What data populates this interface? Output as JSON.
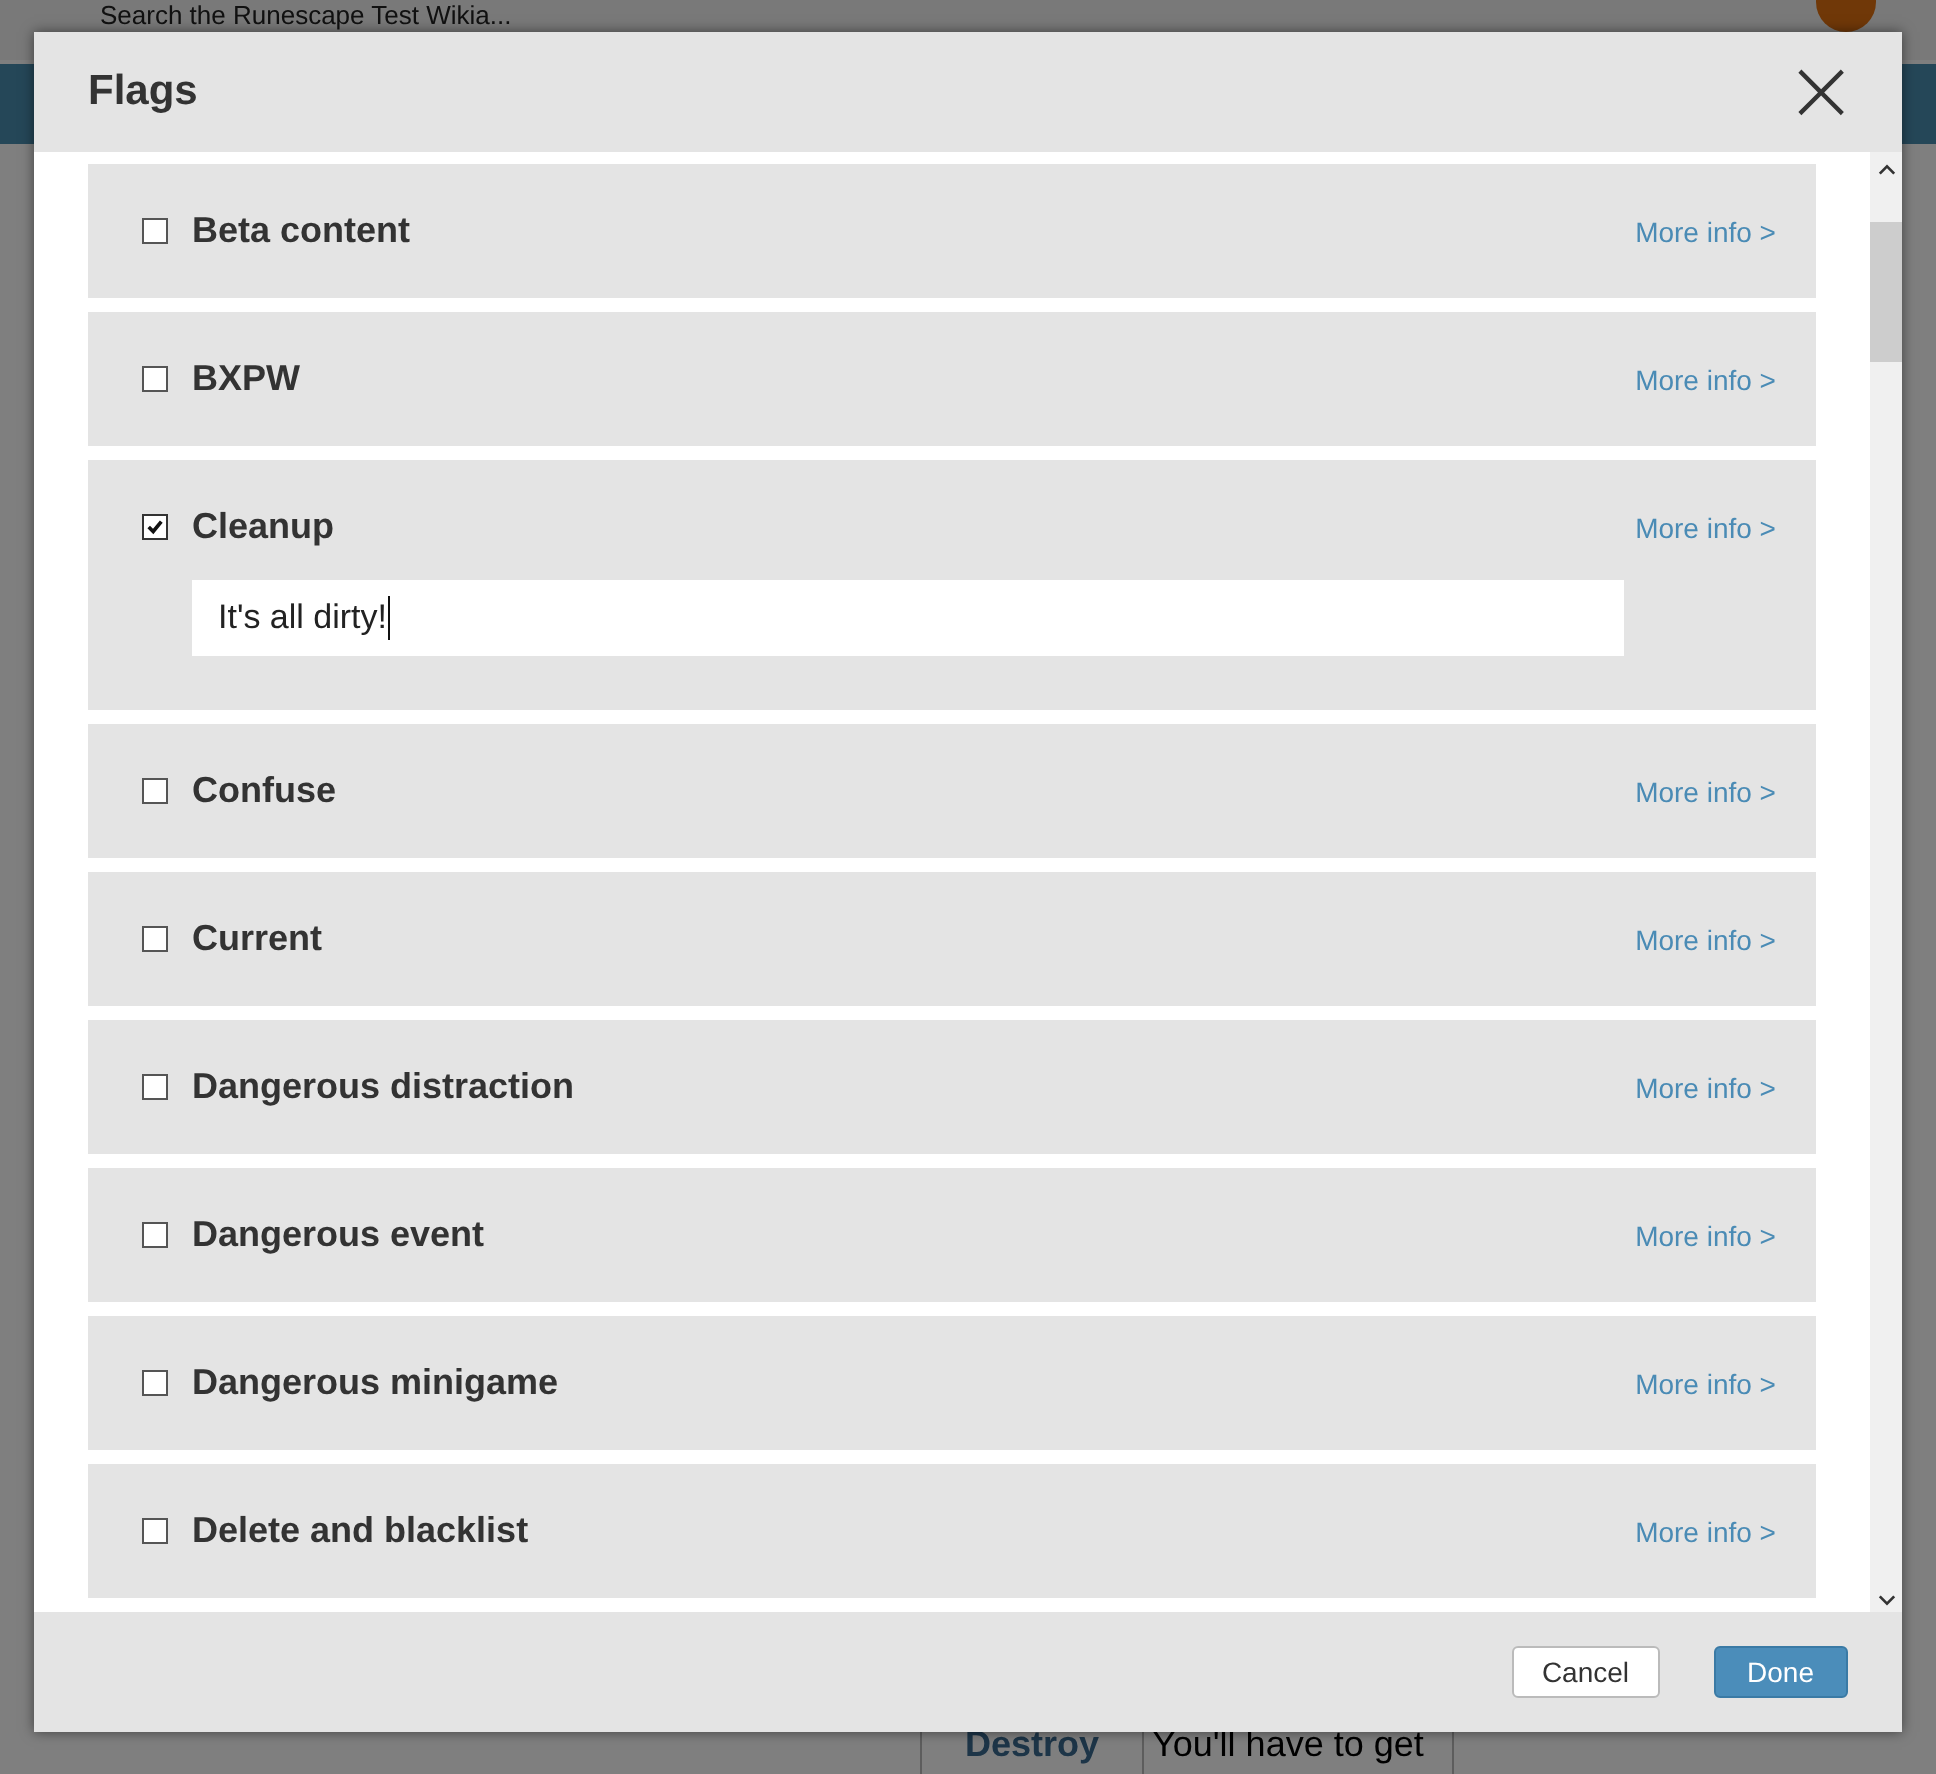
{
  "background": {
    "search_placeholder": "Search the Runescape Test Wikia...",
    "table_row": [
      "Destroy",
      "You'll have to get"
    ]
  },
  "dialog": {
    "title": "Flags",
    "close": "×"
  },
  "flags": [
    {
      "label": "Beta content",
      "checked": false,
      "link": "More info >"
    },
    {
      "label": "BXPW",
      "checked": false,
      "link": "More info >"
    },
    {
      "label": "Cleanup",
      "checked": true,
      "link": "More info >",
      "value": "It's all dirty!"
    },
    {
      "label": "Confuse",
      "checked": false,
      "link": "More info >"
    },
    {
      "label": "Current",
      "checked": false,
      "link": "More info >"
    },
    {
      "label": "Dangerous distraction",
      "checked": false,
      "link": "More info >"
    },
    {
      "label": "Dangerous event",
      "checked": false,
      "link": "More info >"
    },
    {
      "label": "Dangerous minigame",
      "checked": false,
      "link": "More info >"
    },
    {
      "label": "Delete and blacklist",
      "checked": false,
      "link": "More info >"
    }
  ],
  "buttons": [
    {
      "label": "Cancel",
      "kind": "secondary"
    },
    {
      "label": "Done",
      "kind": "primary"
    }
  ]
}
